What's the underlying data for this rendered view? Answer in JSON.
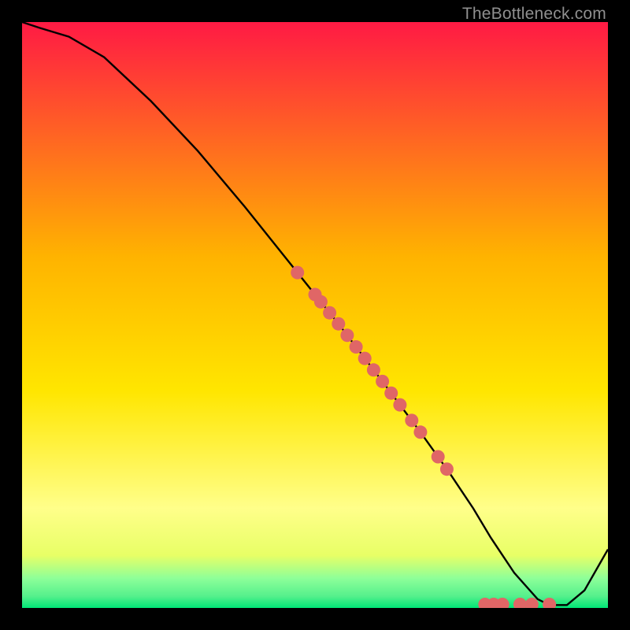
{
  "watermark": "TheBottleneck.com",
  "colors": {
    "top": "#ff1a44",
    "mid_upper": "#ffb300",
    "mid": "#ffe600",
    "mid_lower": "#e8ff66",
    "green_light": "#8cff99",
    "green": "#00e676",
    "marker": "#e06666",
    "marker_stroke": "#000000",
    "curve": "#000000"
  },
  "chart_data": {
    "type": "line",
    "title": "",
    "xlabel": "",
    "ylabel": "",
    "xlim": [
      0,
      100
    ],
    "ylim": [
      0,
      100
    ],
    "curve": {
      "x": [
        0,
        3,
        8,
        14,
        22,
        30,
        38,
        46,
        54,
        62,
        68,
        73,
        77,
        80,
        84,
        88,
        90,
        93,
        96,
        100
      ],
      "y": [
        100,
        99,
        97.5,
        94,
        86.5,
        78,
        68.5,
        58.5,
        48.5,
        38,
        30,
        23,
        17,
        12,
        6,
        1.5,
        0.5,
        0.5,
        3,
        10
      ]
    },
    "markers_on_curve_x": [
      47,
      50,
      51,
      52.5,
      54,
      55.5,
      57,
      58.5,
      60,
      61.5,
      63,
      64.5,
      66.5,
      68,
      71,
      72.5
    ],
    "markers_flat_x": [
      79,
      80.5,
      82,
      85,
      87,
      90
    ],
    "flat_y": 0.6
  }
}
